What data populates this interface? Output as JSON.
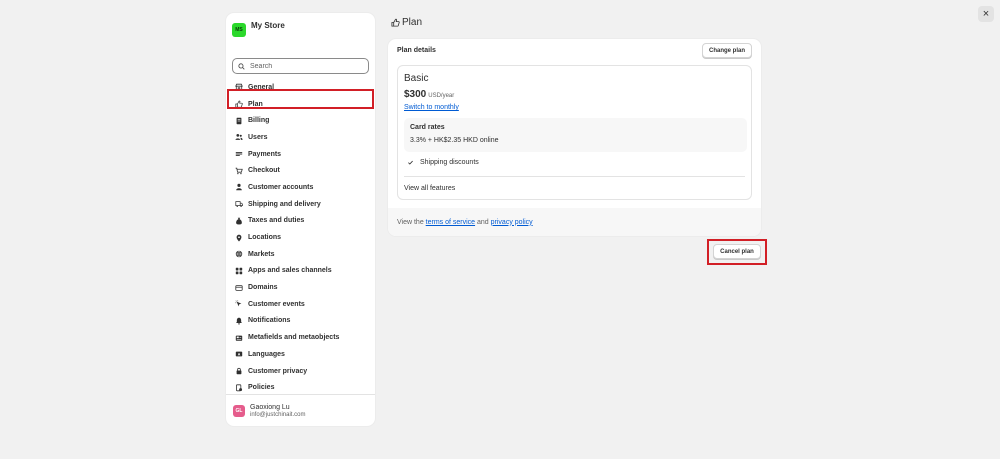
{
  "close_symbol": "×",
  "sidebar": {
    "store_initials": "MS",
    "store_name": "My Store",
    "search_placeholder": "Search",
    "items": [
      {
        "label": "General",
        "icon": "store-icon"
      },
      {
        "label": "Plan",
        "icon": "plan-icon"
      },
      {
        "label": "Billing",
        "icon": "billing-icon"
      },
      {
        "label": "Users",
        "icon": "users-icon"
      },
      {
        "label": "Payments",
        "icon": "payments-icon"
      },
      {
        "label": "Checkout",
        "icon": "cart-icon"
      },
      {
        "label": "Customer accounts",
        "icon": "person-icon"
      },
      {
        "label": "Shipping and delivery",
        "icon": "truck-icon"
      },
      {
        "label": "Taxes and duties",
        "icon": "money-bag-icon"
      },
      {
        "label": "Locations",
        "icon": "location-pin-icon"
      },
      {
        "label": "Markets",
        "icon": "globe-icon"
      },
      {
        "label": "Apps and sales channels",
        "icon": "apps-icon"
      },
      {
        "label": "Domains",
        "icon": "domain-icon"
      },
      {
        "label": "Customer events",
        "icon": "cursor-icon"
      },
      {
        "label": "Notifications",
        "icon": "bell-icon"
      },
      {
        "label": "Metafields and metaobjects",
        "icon": "metafields-icon"
      },
      {
        "label": "Languages",
        "icon": "language-icon"
      },
      {
        "label": "Customer privacy",
        "icon": "lock-icon"
      },
      {
        "label": "Policies",
        "icon": "policy-icon"
      }
    ],
    "selected_item": "Plan",
    "user": {
      "initials": "GL",
      "name": "Gaoxiong Lu",
      "email": "info@justchinait.com"
    }
  },
  "page": {
    "title": "Plan",
    "card": {
      "title": "Plan details",
      "change_plan_label": "Change plan",
      "plan_name": "Basic",
      "price": "$300",
      "price_unit": "USD/year",
      "switch_link": "Switch to monthly",
      "card_rates_title": "Card rates",
      "card_rates_value": "3.3% + HK$2.35 HKD online",
      "shipping_label": "Shipping discounts",
      "view_all_label": "View all features",
      "footer_prefix": "View the ",
      "footer_terms": "terms of service",
      "footer_and": " and ",
      "footer_privacy": "privacy policy"
    },
    "cancel_plan_label": "Cancel plan"
  },
  "colors": {
    "accent_link": "#005bd3",
    "highlight": "#d21f26",
    "store_avatar": "#2bd82b",
    "user_avatar": "#e55c8c"
  }
}
